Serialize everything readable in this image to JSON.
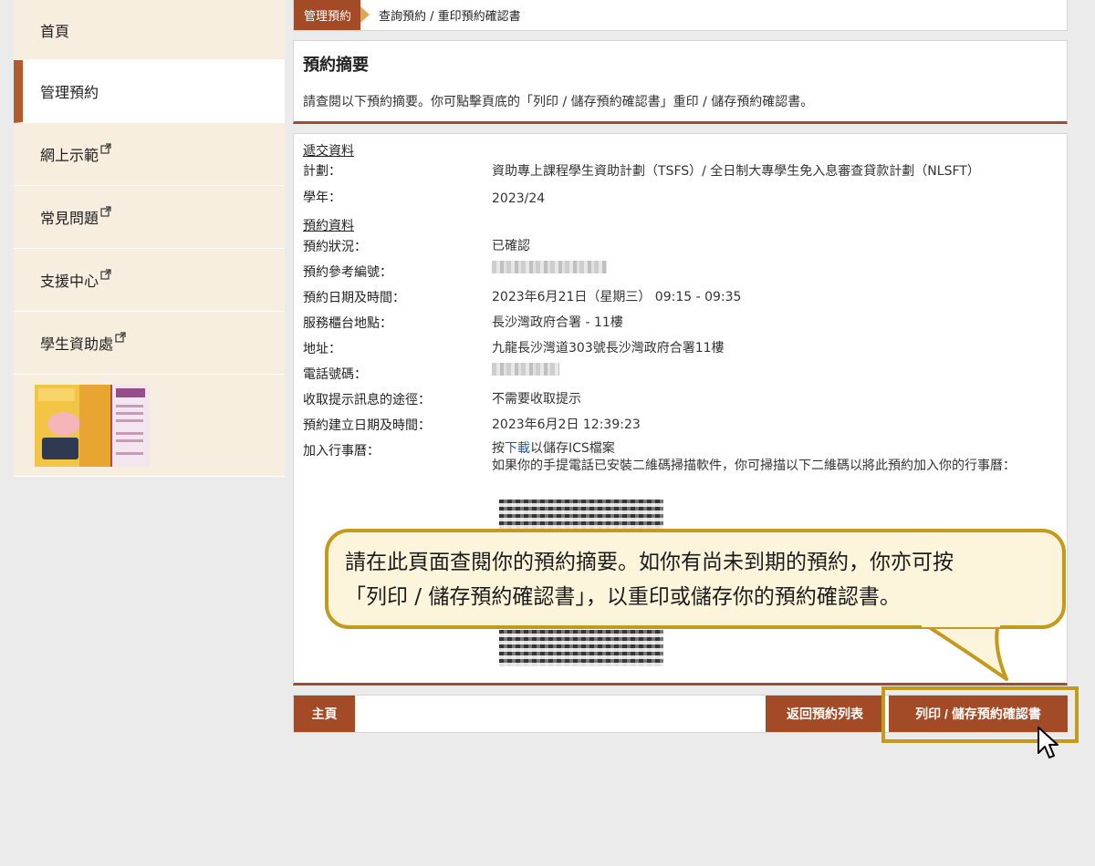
{
  "sidebar": {
    "items": [
      {
        "label": "首頁",
        "external": false,
        "active": false
      },
      {
        "label": "管理預約",
        "external": false,
        "active": true
      },
      {
        "label": "網上示範",
        "external": true,
        "active": false
      },
      {
        "label": "常見問題",
        "external": true,
        "active": false
      },
      {
        "label": "支援中心",
        "external": true,
        "active": false
      },
      {
        "label": "學生資助處",
        "external": true,
        "active": false
      }
    ]
  },
  "breadcrumb": {
    "parent": "管理預約",
    "current": "查詢預約 / 重印預約確認書"
  },
  "summary": {
    "title": "預約摘要",
    "description": "請查閱以下預約摘要。你可點擊頁底的「列印 / 儲存預約確認書」重印 / 儲存預約確認書。"
  },
  "submission": {
    "section_title": "遞交資料",
    "plan_label": "計劃：",
    "plan_value": "資助專上課程學生資助計劃（TSFS）/ 全日制大專學生免入息審查貸款計劃（NLSFT）",
    "year_label": "學年：",
    "year_value": "2023/24"
  },
  "booking": {
    "section_title": "預約資料",
    "status_label": "預約狀況：",
    "status_value": "已確認",
    "ref_label": "預約參考編號：",
    "datetime_label": "預約日期及時間：",
    "datetime_value": "2023年6月21日（星期三） 09:15 - 09:35",
    "counter_label": "服務櫃台地點：",
    "counter_value": "長沙灣政府合署 - 11樓",
    "address_label": "地址：",
    "address_value": "九龍長沙灣道303號長沙灣政府合署11樓",
    "phone_label": "電話號碼：",
    "reminder_label": "收取提示訊息的途徑：",
    "reminder_value": "不需要收取提示",
    "created_label": "預約建立日期及時間：",
    "created_value": "2023年6月2日 12:39:23",
    "calendar_label": "加入行事曆：",
    "calendar_pre": "按",
    "calendar_link": "下載",
    "calendar_post": "以儲存ICS檔案",
    "calendar_qr_text": "如果你的手提電話已安裝二維碼掃描軟件，你可掃描以下二維碼以將此預約加入你的行事曆："
  },
  "buttons": {
    "home": "主頁",
    "back": "返回預約列表",
    "print": "列印 / 儲存預約確認書"
  },
  "callout": {
    "line1": "請在此頁面查閱你的預約摘要。如你有尚未到期的預約，你亦可按",
    "line2": "「列印 / 儲存預約確認書」，以重印或儲存你的預約確認書。"
  },
  "colors": {
    "accent": "#a34a26",
    "highlight": "#c49a1c",
    "sidebar_bg": "#f8eedf",
    "callout_bg": "#fdf4dc"
  },
  "icons": {
    "external": "external-link-icon",
    "cursor": "mouse-pointer-icon"
  }
}
